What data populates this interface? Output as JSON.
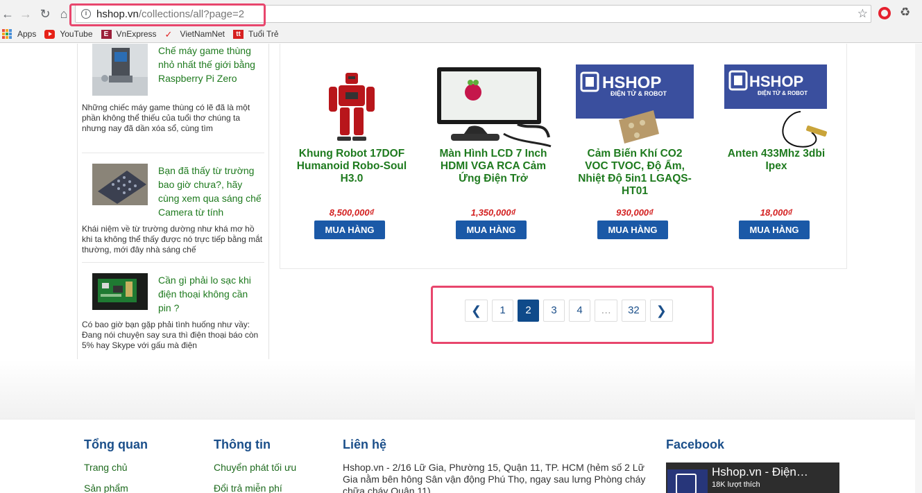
{
  "browser": {
    "url_host": "hshop.vn",
    "url_path": "/collections/all?page=2",
    "bookmarks": [
      {
        "label": "Apps",
        "icon": "apps-grid-icon"
      },
      {
        "label": "YouTube",
        "icon": "youtube-icon"
      },
      {
        "label": "VnExpress",
        "icon": "vnexpress-icon"
      },
      {
        "label": "VietNamNet",
        "icon": "vietnamnet-icon"
      },
      {
        "label": "Tuổi Trẻ",
        "icon": "tuoitre-icon"
      }
    ]
  },
  "sidebar": {
    "news": [
      {
        "title": "Chế máy game thùng nhỏ nhất thế giới bằng Raspberry Pi Zero",
        "desc": "Những chiếc máy game thùng có lẽ đã là một phần không thể thiếu của tuổi thơ chúng ta nhưng nay đã dần xóa sổ, cùng tìm"
      },
      {
        "title": "Bạn đã thấy từ trường bao giờ chưa?, hãy cùng xem qua sáng chế Camera từ tính",
        "desc": "Khái niệm về từ trường dường như khá mơ hồ khi ta không thể thấy được nó trực tiếp bằng mắt thường, mới đây nhà sáng chế"
      },
      {
        "title": "Cần gì phải lo sạc khi điện thoại không cần pin ?",
        "desc": "Có bao giờ bạn gặp phải tình huống như vầy: Đang nói chuyện say sưa thì điện thoại báo còn 5% hay Skype với gấu mà điện"
      }
    ]
  },
  "products": [
    {
      "name": "Khung Robot 17DOF Humanoid Robo-Soul H3.0",
      "price": "8,500,000₫",
      "buy_label": "MUA HÀNG"
    },
    {
      "name": "Màn Hình LCD 7 Inch HDMI VGA RCA Cảm Ứng Điện Trở",
      "price": "1,350,000₫",
      "buy_label": "MUA HÀNG"
    },
    {
      "name": "Cảm Biến Khí CO2 VOC TVOC, Độ Ẩm, Nhiệt Độ 5in1 LGAQS-HT01",
      "price": "930,000₫",
      "buy_label": "MUA HÀNG"
    },
    {
      "name": "Anten 433Mhz 3dbi Ipex",
      "price": "18,000₫",
      "buy_label": "MUA HÀNG"
    }
  ],
  "product_image_text": {
    "brand": "HSHOP",
    "tagline": "ĐIỆN TỬ & ROBOT"
  },
  "pagination": {
    "pages": [
      "1",
      "2",
      "3",
      "4",
      "…",
      "32"
    ],
    "current": "2"
  },
  "footer": {
    "col1": {
      "title": "Tổng quan",
      "links": [
        "Trang chủ",
        "Sản phẩm"
      ]
    },
    "col2": {
      "title": "Thông tin",
      "links": [
        "Chuyển phát tối ưu",
        "Đổi trả miễn phí"
      ]
    },
    "col3": {
      "title": "Liên hệ",
      "address": "Hshop.vn - 2/16 Lữ Gia, Phường 15, Quận 11, TP. HCM (hẻm số 2 Lữ Gia nằm bên hông Sân vận động Phú Thọ, ngay sau lưng Phòng cháy chữa cháy Quận 11)."
    },
    "col4": {
      "title": "Facebook",
      "page_name": "Hshop.vn - Điện…",
      "likes": "18K lượt thích"
    }
  },
  "colors": {
    "accent_green": "#1e7a1e",
    "button_blue": "#1b59a7",
    "price_red": "#d32020",
    "highlight_pink": "#e8466d"
  }
}
